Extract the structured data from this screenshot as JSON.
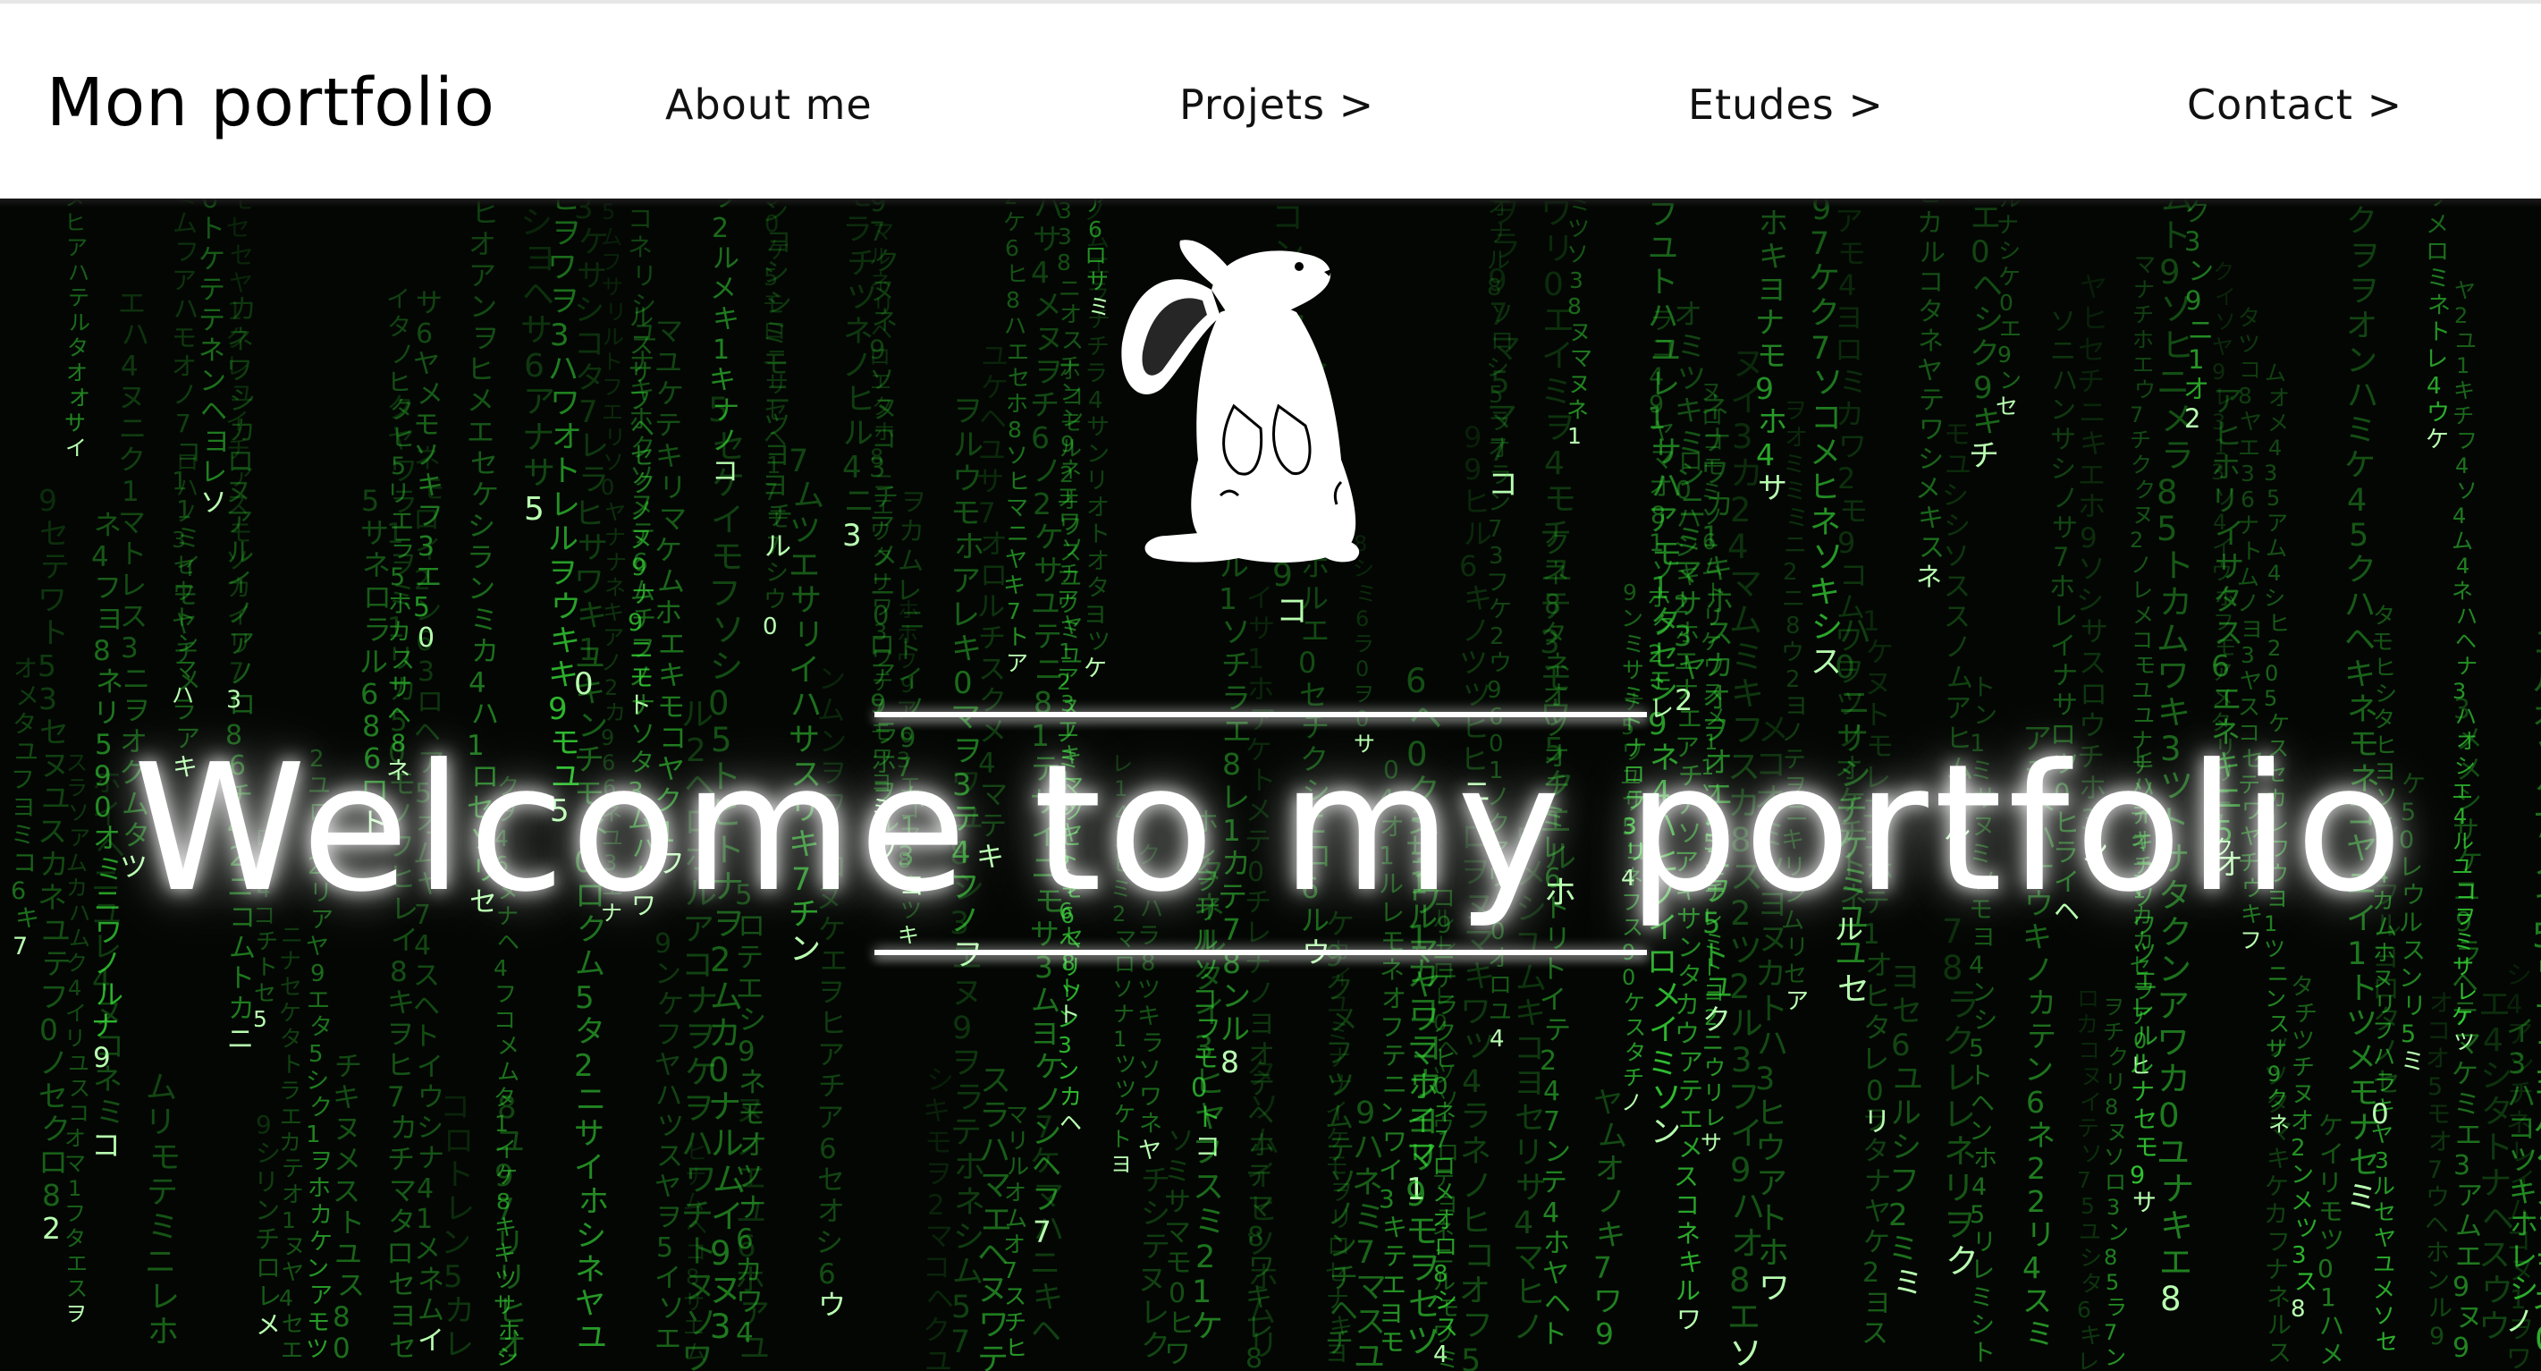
{
  "header": {
    "brand": "Mon portfolio",
    "nav": [
      {
        "label": "About me"
      },
      {
        "label": "Projets >"
      },
      {
        "label": "Etudes >"
      },
      {
        "label": "Contact >"
      }
    ]
  },
  "hero": {
    "title": "Welcome to my portfolio",
    "logo_icon": "white-rabbit-icon",
    "background": "matrix-code-rain"
  },
  "colors": {
    "header_bg": "#ffffff",
    "hero_bg": "#030603",
    "matrix_green": "#39e639",
    "title_color": "#ffffff"
  }
}
